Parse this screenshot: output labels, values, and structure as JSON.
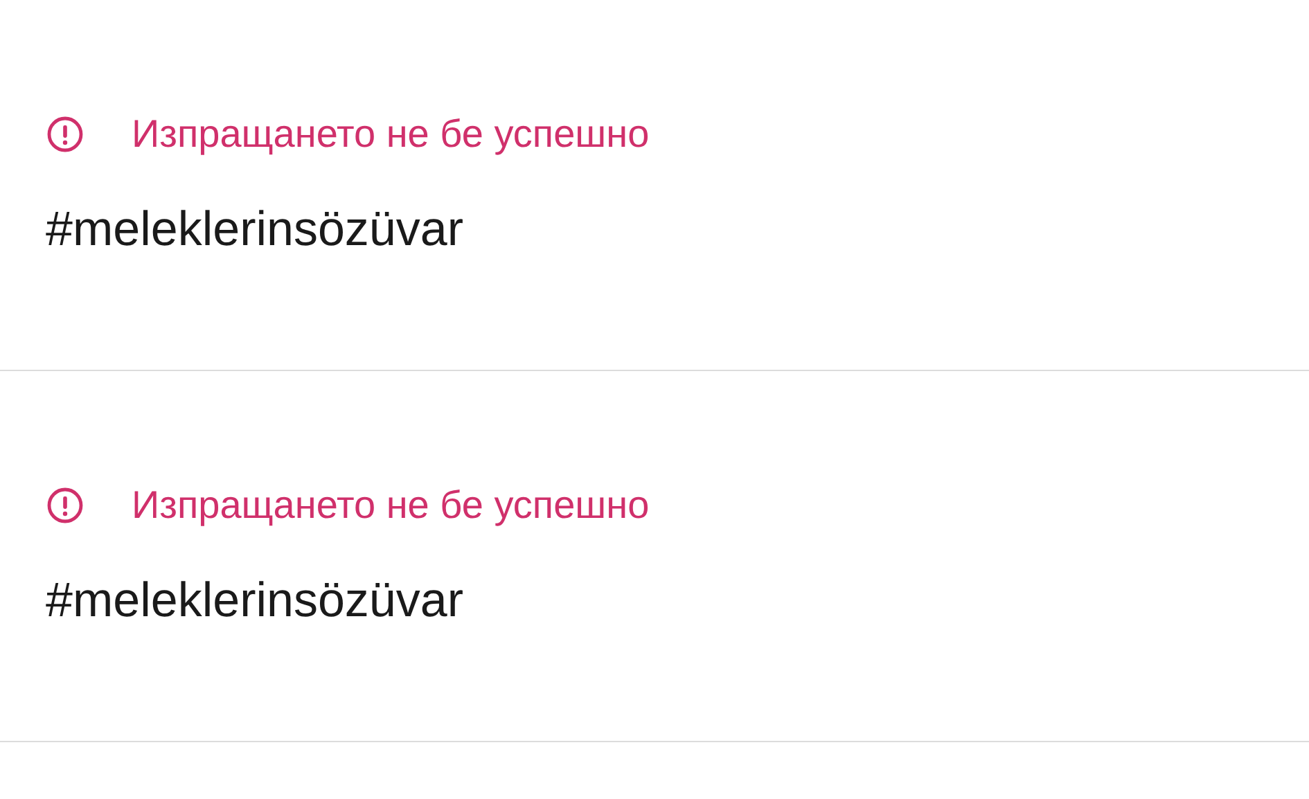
{
  "messages": [
    {
      "failed": true,
      "status_text": "Изпращането не бе успешно",
      "text": "#meleklerinsözüvar"
    },
    {
      "failed": true,
      "status_text": "Изпращането не бе успешно",
      "text": "#meleklerinsözüvar"
    }
  ]
}
